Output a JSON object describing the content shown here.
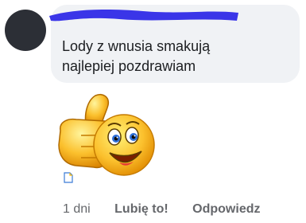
{
  "comment": {
    "lines": [
      "Lody z wnusia smakują",
      "najlepiej pozdrawiam"
    ]
  },
  "sticker": {
    "icon": "thumbs-up-smiley-sticker"
  },
  "actions": {
    "age": "1 dni",
    "like": "Lubię to!",
    "reply": "Odpowiedz"
  },
  "colors": {
    "bubble": "#f0f2f5",
    "redaction": "#3a35e8",
    "text": "#1c1e21",
    "meta": "#65676b"
  }
}
